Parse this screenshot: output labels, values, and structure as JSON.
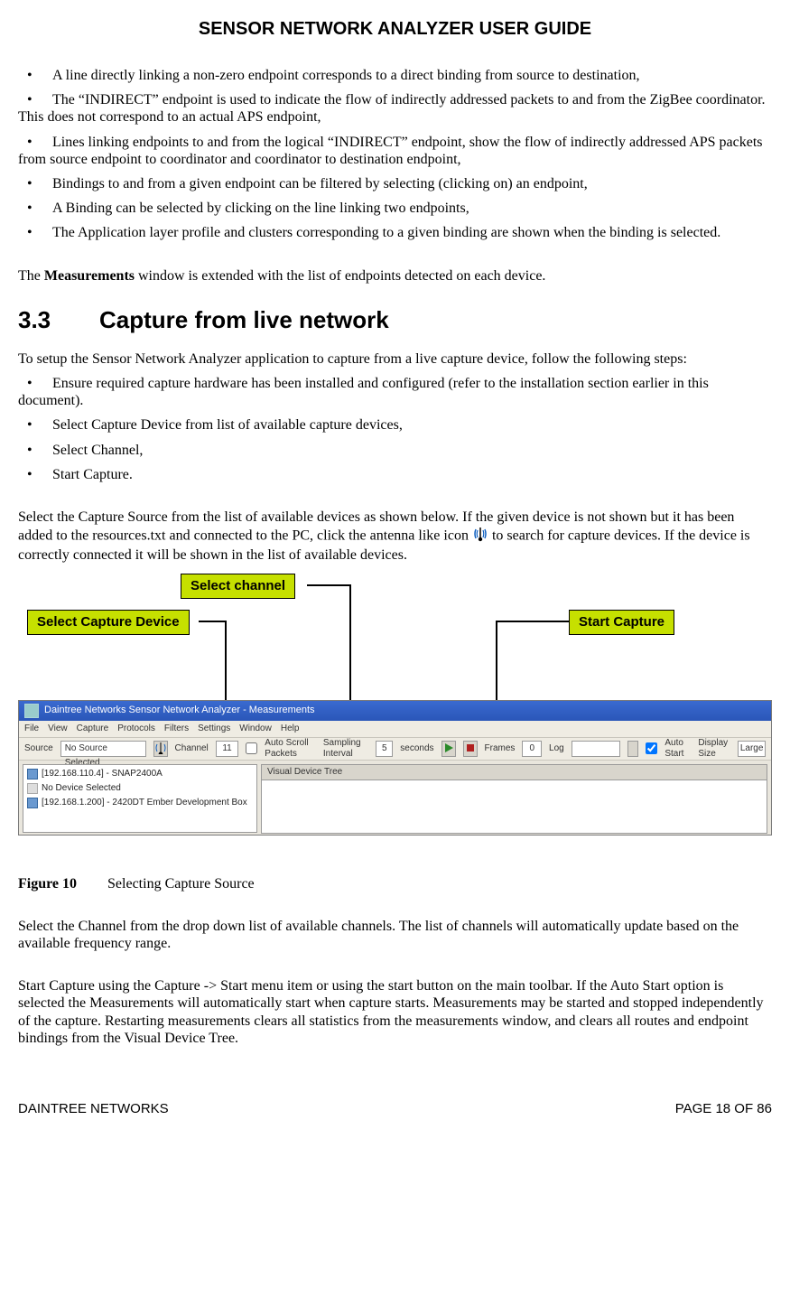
{
  "header": {
    "title": "SENSOR NETWORK ANALYZER USER GUIDE"
  },
  "bullets1": {
    "b0": "A line directly linking a non-zero endpoint corresponds to a direct binding from source to destination,",
    "b1": "The “INDIRECT” endpoint is used to indicate the flow of indirectly addressed packets to and from the ZigBee coordinator. This does not correspond to an actual APS endpoint,",
    "b2": "Lines linking endpoints to and from the logical “INDIRECT” endpoint, show the flow of indirectly addressed APS packets from source endpoint to coordinator and coordinator to destination endpoint,",
    "b3": "Bindings to and from a given endpoint can be filtered by selecting (clicking on) an endpoint,",
    "b4": "A Binding can be selected by clicking on the line linking two endpoints,",
    "b5": "The Application layer profile and clusters corresponding to a given binding are shown when the binding is selected."
  },
  "measurements_sentence": {
    "pre": "The ",
    "bold": "Measurements",
    "post": " window is extended with the list of endpoints detected on each device."
  },
  "section": {
    "num": "3.3",
    "title": "Capture from live network"
  },
  "para_setup": "To setup the Sensor Network Analyzer application to capture from a live capture device, follow the following steps:",
  "bullets2": {
    "b0": "Ensure required capture hardware has been installed and configured (refer to the installation section earlier in this document).",
    "b1": "Select Capture Device from list of available capture devices,",
    "b2": "Select Channel,",
    "b3": "Start Capture."
  },
  "select_source_para": {
    "part1": "Select the Capture Source from the list of available devices as shown below. If the given device is not shown but it has been added to the resources.txt and connected to the PC, click the antenna like icon ",
    "part2": " to search for capture devices. If the device is correctly connected it will be shown in the list of available devices."
  },
  "callouts": {
    "select_channel": "Select channel",
    "select_device": "Select Capture Device",
    "start_capture": "Start Capture"
  },
  "ui": {
    "title": "Daintree Networks Sensor Network Analyzer - Measurements",
    "menus": [
      "File",
      "View",
      "Capture",
      "Protocols",
      "Filters",
      "Settings",
      "Window",
      "Help"
    ],
    "toolbar": {
      "source_label": "Source",
      "source_value": "No Source Selected",
      "channel_label": "Channel",
      "channel_value": "11",
      "autoscroll": "Auto Scroll Packets",
      "sampling_label": "Sampling Interval",
      "sampling_value": "5",
      "sampling_unit": "seconds",
      "frames_label": "Frames",
      "frames_value": "0",
      "log_label": "Log",
      "autostart": "Auto Start",
      "display_label": "Display Size",
      "display_value": "Large"
    },
    "devices": {
      "r0": "[192.168.110.4] - SNAP2400A",
      "r1": "No Device Selected",
      "r2": "[192.168.1.200] - 2420DT Ember Development Box"
    },
    "right_header": "Visual Device Tree"
  },
  "figure": {
    "label": "Figure 10",
    "caption": "Selecting Capture Source"
  },
  "para_channel": "Select the Channel from the drop down list of available channels. The list of channels will automatically update based on the available frequency range.",
  "para_start": "Start Capture using the Capture -> Start menu item or using the start button on the main toolbar. If the Auto Start option is selected the Measurements will automatically start when capture starts. Measurements may be started and stopped independently of the capture. Restarting measurements clears all statistics from the measurements window, and clears all routes and endpoint bindings from the Visual Device Tree.",
  "footer": {
    "left": "DAINTREE NETWORKS",
    "right": "PAGE 18 OF 86"
  }
}
